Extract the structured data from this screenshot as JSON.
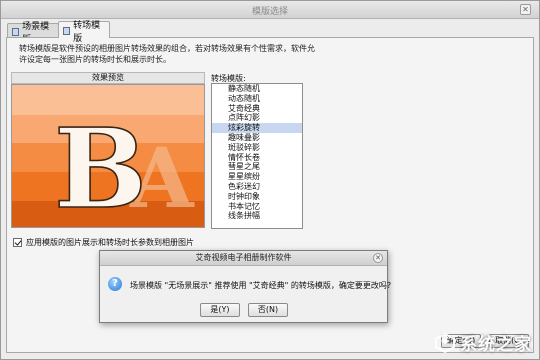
{
  "window": {
    "title": "模版选择",
    "close_glyph": "✕"
  },
  "tabs": [
    {
      "label": "场景模版",
      "active": false
    },
    {
      "label": "转场模版",
      "active": true
    }
  ],
  "description": "转场模版是软件预设的相册图片转场效果的组合，若对转场效果有个性需求，软件允许设定每一张图片的转场时长和展示时长。",
  "preview": {
    "header": "效果预览",
    "letter": "B",
    "ghost_letter": "A",
    "colors": [
      "#fbbf95",
      "#f8a870",
      "#f48d43",
      "#ee7422",
      "#d85d12"
    ]
  },
  "list": {
    "label": "转场模版:",
    "items": [
      "静态随机",
      "动态随机",
      "艾奇经典",
      "点阵幻影",
      "炫彩旋转",
      "趣味叠影",
      "斑驳碎影",
      "情怀长卷",
      "彗星之尾",
      "星星缤纷",
      "色彩迷幻",
      "时钟印象",
      "书本记忆",
      "线条拼幅"
    ],
    "selected_index": 4
  },
  "checkbox": {
    "label": "应用模版的图片展示和转场时长参数到相册图片",
    "checked": true
  },
  "buttons": {
    "ok": "确定(O)",
    "cancel": "取消(C)"
  },
  "dialog": {
    "title": "艾奇视频电子相册制作软件",
    "message": "场景模版 \"无场景展示\" 推荐使用 \"艾奇经典\" 的转场模版，确定要更改吗?",
    "yes": "是(Y)",
    "no": "否(N)",
    "icon": "question-icon",
    "close_glyph": "✕"
  },
  "watermark": {
    "text": "系统之家"
  }
}
